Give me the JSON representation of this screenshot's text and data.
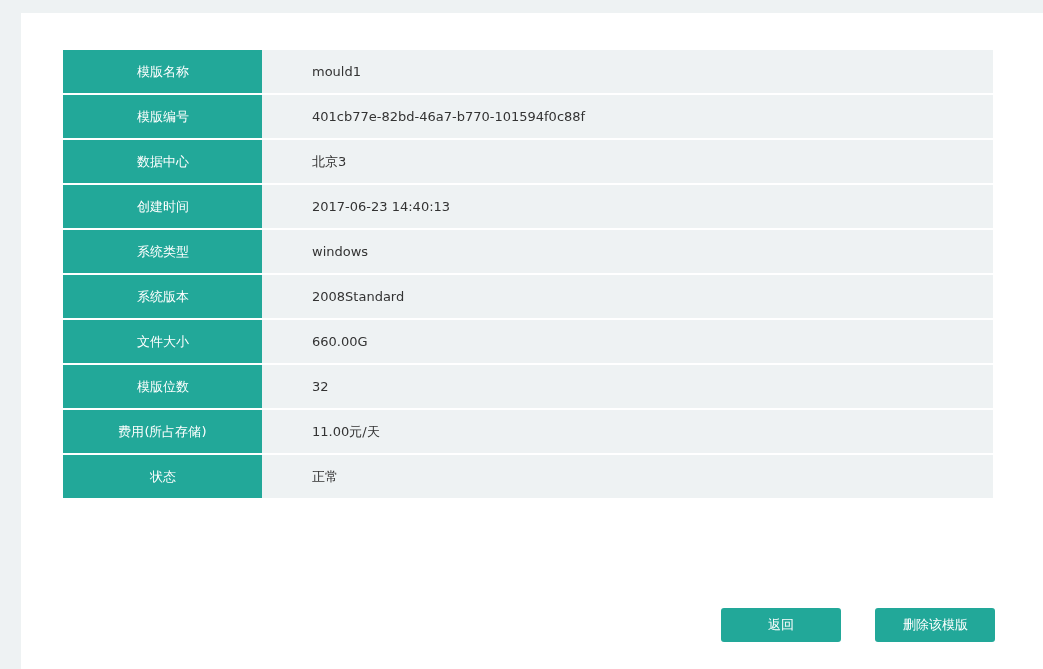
{
  "details": [
    {
      "label": "模版名称",
      "value": "mould1"
    },
    {
      "label": "模版编号",
      "value": "401cb77e-82bd-46a7-b770-101594f0c88f"
    },
    {
      "label": "数据中心",
      "value": "北京3"
    },
    {
      "label": "创建时间",
      "value": "2017-06-23 14:40:13"
    },
    {
      "label": "系统类型",
      "value": "windows"
    },
    {
      "label": "系统版本",
      "value": "2008Standard"
    },
    {
      "label": "文件大小",
      "value": "660.00G"
    },
    {
      "label": "模版位数",
      "value": "32"
    },
    {
      "label": "费用(所占存储)",
      "value": "11.00元/天"
    },
    {
      "label": "状态",
      "value": "正常"
    }
  ],
  "buttons": [
    "返回",
    "删除该模版"
  ]
}
